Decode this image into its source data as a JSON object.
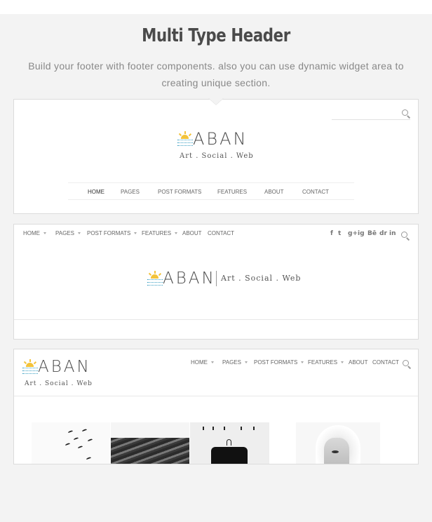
{
  "header": {
    "title": "Multi Type Header",
    "subtitle": "Build your footer with footer components. also you can use dynamic widget area to creating unique section."
  },
  "brand": {
    "logo_text": "ABAN",
    "tagline": "Art . Social . Web"
  },
  "colors": {
    "sun": "#f3c33a",
    "wave": "#3a9fc2",
    "text": "#4c4c4c"
  },
  "panel1": {
    "nav": [
      "HOME",
      "PAGES",
      "POST FORMATS",
      "FEATURES",
      "ABOUT",
      "CONTACT"
    ],
    "icons": [
      "search-icon"
    ]
  },
  "panel2": {
    "nav": [
      "HOME",
      "PAGES",
      "POST FORMATS",
      "FEATURES",
      "ABOUT",
      "CONTACT"
    ],
    "social": [
      "f",
      "t",
      "g+",
      "ig",
      "Bē",
      "dr",
      "in"
    ],
    "icons": [
      "facebook-icon",
      "twitter-icon",
      "google-plus-icon",
      "instagram-icon",
      "behance-icon",
      "dribbble-icon",
      "linkedin-icon",
      "search-icon"
    ]
  },
  "panel3": {
    "nav": [
      "HOME",
      "PAGES",
      "POST FORMATS",
      "FEATURES",
      "ABOUT",
      "CONTACT"
    ],
    "images": [
      "birds",
      "roof",
      "hanger",
      "hood"
    ]
  }
}
